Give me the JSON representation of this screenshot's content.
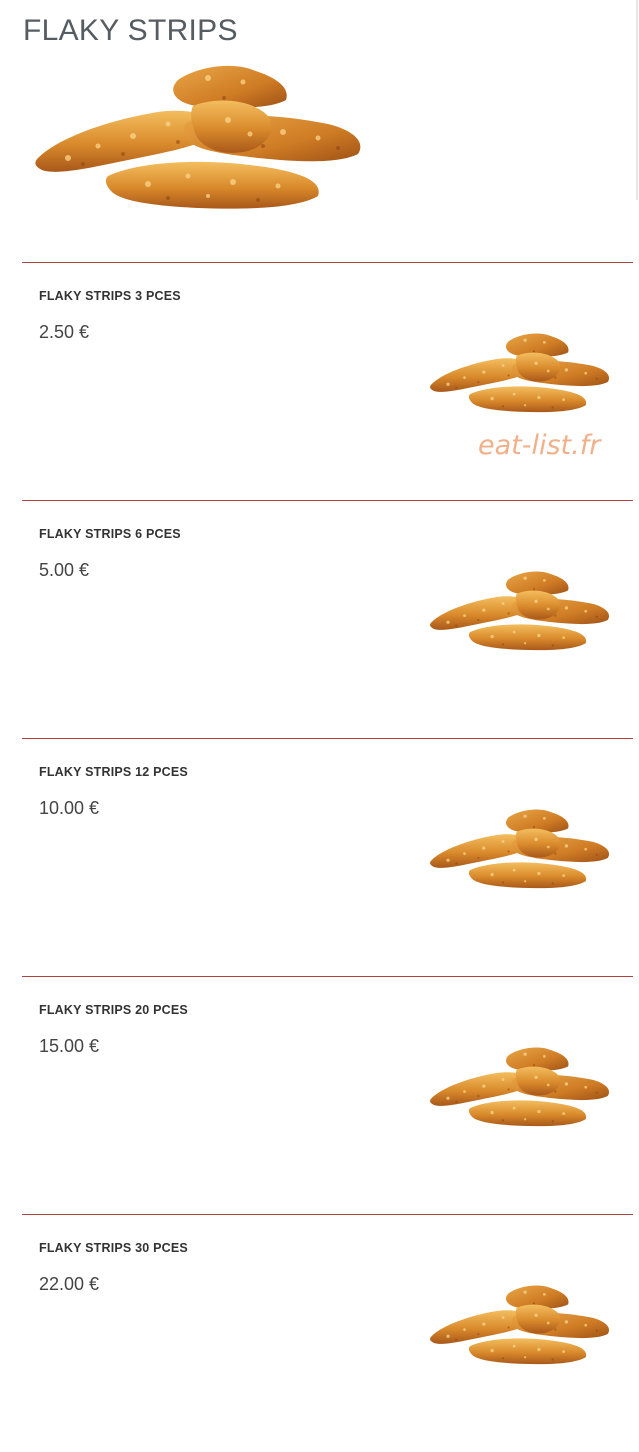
{
  "category": {
    "title": "FLAKY STRIPS",
    "hero_image": "fried-chicken-strips-photo"
  },
  "watermark": "eat-list.fr",
  "items": [
    {
      "name": "FLAKY STRIPS 3 PCES",
      "price": "2.50 €",
      "image": "fried-chicken-strips-photo"
    },
    {
      "name": "FLAKY STRIPS 6 PCES",
      "price": "5.00 €",
      "image": "fried-chicken-strips-photo"
    },
    {
      "name": "FLAKY STRIPS 12 PCES",
      "price": "10.00 €",
      "image": "fried-chicken-strips-photo"
    },
    {
      "name": "FLAKY STRIPS 20 PCES",
      "price": "15.00 €",
      "image": "fried-chicken-strips-photo"
    },
    {
      "name": "FLAKY STRIPS 30 PCES",
      "price": "22.00 €",
      "image": "fried-chicken-strips-photo"
    }
  ],
  "colors": {
    "divider": "#b3413f",
    "title": "#555d63",
    "watermark": "#f1b089",
    "strip_dark": "#b8661c",
    "strip_mid": "#d98a2b",
    "strip_light": "#f0b456"
  }
}
